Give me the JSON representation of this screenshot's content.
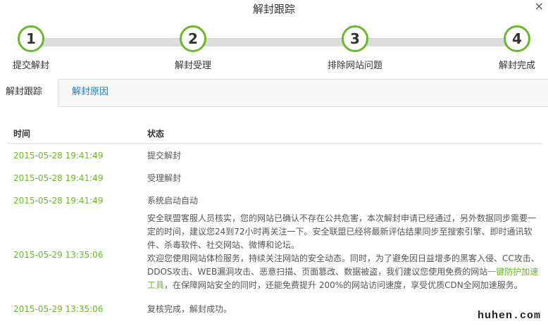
{
  "dialog": {
    "title": "解封跟踪",
    "close_glyph": "×"
  },
  "steps": [
    {
      "number": "1",
      "label": "提交解封"
    },
    {
      "number": "2",
      "label": "解封受理"
    },
    {
      "number": "3",
      "label": "排除网站问题"
    },
    {
      "number": "4",
      "label": "解封完成"
    }
  ],
  "tabs": [
    {
      "label": "解封跟踪",
      "active": true
    },
    {
      "label": "解封原因",
      "active": false
    }
  ],
  "table": {
    "headers": {
      "time": "时间",
      "status": "状态"
    },
    "rows": [
      {
        "time": "2015-05-28 19:41:49",
        "status": "提交解封"
      },
      {
        "time": "2015-05-28 19:41:49",
        "status": "受理解封"
      },
      {
        "time": "2015-05-28 19:41:49",
        "status": "系统启动自动"
      },
      {
        "time": "2015-05-29 13:35:06",
        "status_p1": "安全联盟客服人员核实，您的网站已确认不存在公共危害，本次解封申请已经通过，另外数据同步需要一定的时间，建议您24到72小时再关注一下。安全联盟已经将最新评估结果同步至搜索引擎、即时通讯软件、杀毒软件、社交网站、微博和论坛。",
        "status_p2_pre": "欢迎您使用网站体检服务，持续关注网站的安全动态。同时，为了避免因日益增多的黑客入侵、CC攻击、DDOS攻击、WEB漏洞攻击、恶意扫描、页面篡改、数据被盗，我们建议您使用免费的网站",
        "status_p2_link": "一键防护加速工具",
        "status_p2_post": "，在保障网站安全的同时，还能免费提升 200%的网站访问速度，享受优质CDN全网加速服务。"
      },
      {
        "time": "2015-05-29 13:35:06",
        "status": "复核完成，解封成功。"
      }
    ]
  },
  "colors": {
    "accent_green": "#6ab72c",
    "link_blue": "#2a7ab9"
  },
  "watermark": "huhen.com"
}
